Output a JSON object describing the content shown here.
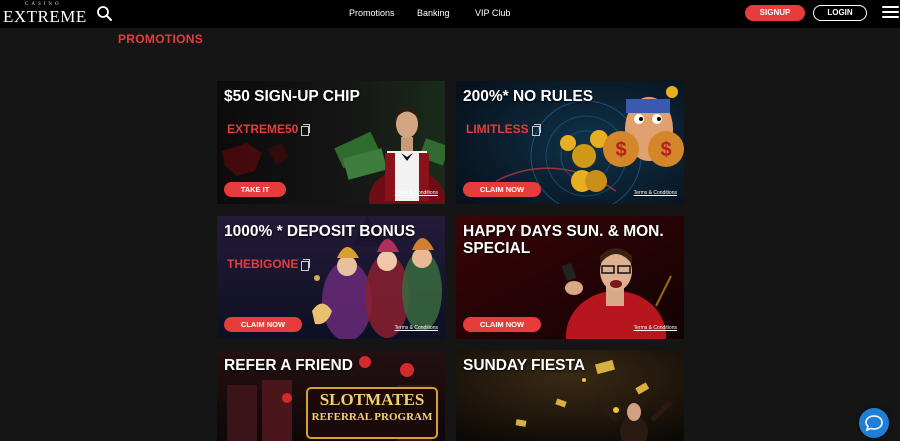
{
  "brand": {
    "small": "CASINO",
    "name": "EXTREME"
  },
  "nav": {
    "promotions": "Promotions",
    "banking": "Banking",
    "vip": "VIP Club"
  },
  "header": {
    "signup": "SIGNUP",
    "login": "LOGIN"
  },
  "page_title": "PROMOTIONS",
  "colors": {
    "accent": "#e63c3c",
    "header_bg": "#000000",
    "page_bg": "#151515",
    "chat": "#1f7fd6"
  },
  "cards": [
    {
      "title": "$50 SIGN-UP CHIP",
      "code": "EXTREME50",
      "button": "TAKE IT",
      "terms": "Terms & Conditions"
    },
    {
      "title": "200%* NO RULES",
      "code": "LIMITLESS",
      "button": "CLAIM NOW",
      "terms": "Terms & Conditions"
    },
    {
      "title": "1000% * DEPOSIT BONUS",
      "code": "THEBIGONE",
      "button": "CLAIM NOW",
      "terms": "Terms & Conditions"
    },
    {
      "title_line1": "HAPPY DAYS SUN. & MON.",
      "title_line2": "SPECIAL",
      "button": "CLAIM NOW",
      "terms": "Terms & Conditions"
    },
    {
      "title": "REFER A FRIEND",
      "banner_line1": "SLOTMATES",
      "banner_line2": "REFERRAL PROGRAM"
    },
    {
      "title": "SUNDAY FIESTA"
    }
  ],
  "icons": {
    "search": "search-icon",
    "menu": "hamburger-menu-icon",
    "copy": "copy-icon",
    "chat": "chat-bubble-icon"
  }
}
